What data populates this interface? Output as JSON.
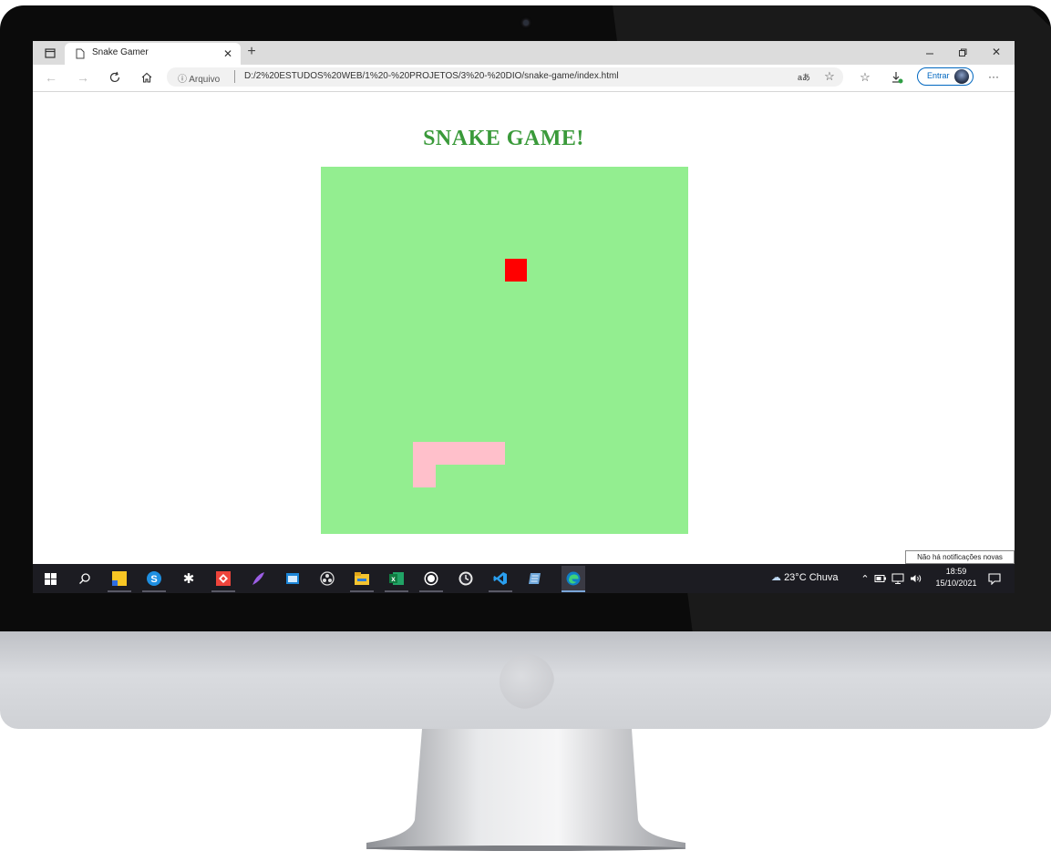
{
  "browser": {
    "tab_title": "Snake Gamer",
    "address_label": "Arquivo",
    "url": "D:/2%20ESTUDOS%20WEB/1%20-%20PROJETOS/3%20-%20DIO/snake-game/index.html",
    "read_aloud": "aあ",
    "signin_label": "Entrar",
    "more_label": "···"
  },
  "page": {
    "title": "SNAKE GAME!"
  },
  "game": {
    "board_color": "#93ee90",
    "food_color": "#ff0000",
    "snake_color": "#ffc0cb"
  },
  "notification": {
    "text": "Não há notificações novas"
  },
  "taskbar": {
    "weather": "23°C  Chuva",
    "time": "18:59",
    "date": "15/10/2021",
    "apps": [
      "start-icon",
      "search-icon",
      "sticky-notes-icon",
      "skype-icon",
      "settings-icon",
      "anydesk-icon",
      "feather-icon",
      "window-app-icon",
      "obs-icon",
      "file-explorer-icon",
      "excel-icon",
      "whatsapp-icon",
      "clock-app-icon",
      "vscode-icon",
      "notepad-icon",
      "edge-icon"
    ]
  }
}
